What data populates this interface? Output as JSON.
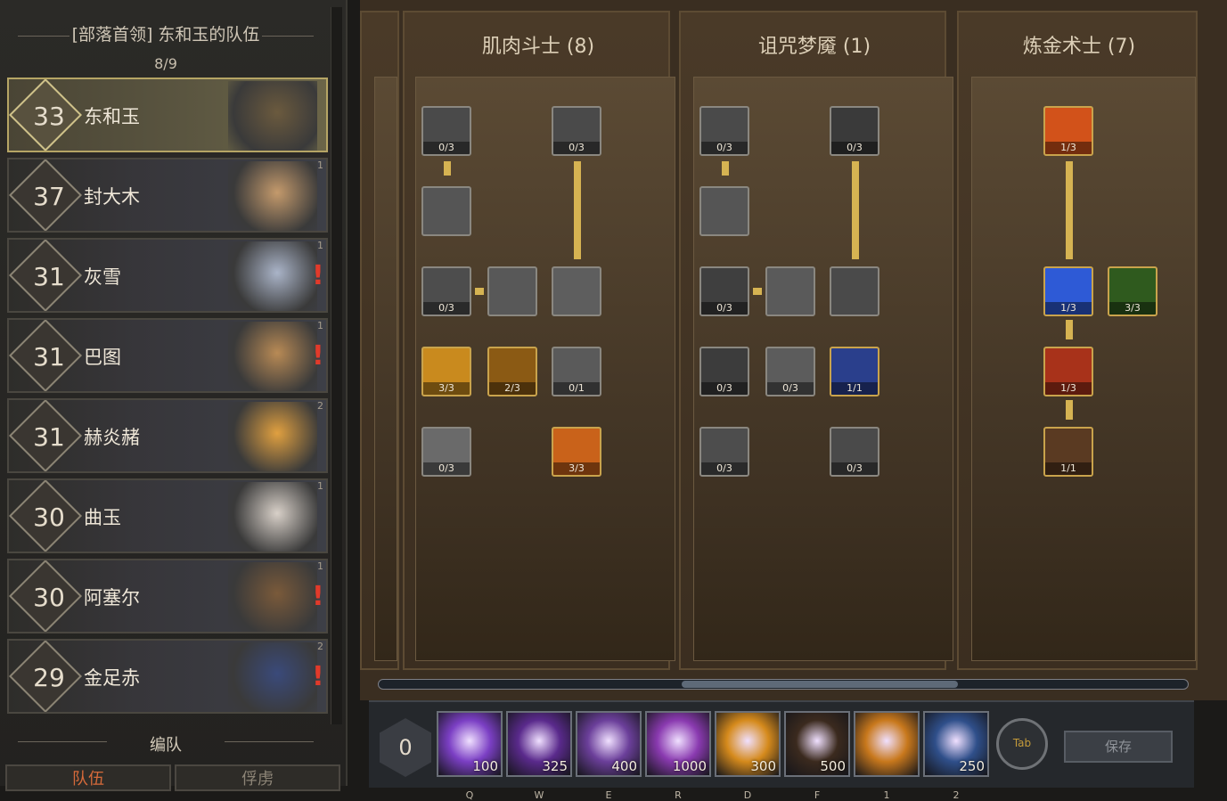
{
  "party": {
    "header": "[部落首领] 东和玉的队伍",
    "count": "8/9",
    "members": [
      {
        "level": "33",
        "name": "东和玉",
        "badge": "",
        "alert": "",
        "selected": true
      },
      {
        "level": "37",
        "name": "封大木",
        "badge": "1",
        "alert": ""
      },
      {
        "level": "31",
        "name": "灰雪",
        "badge": "1",
        "alert": "!"
      },
      {
        "level": "31",
        "name": "巴图",
        "badge": "1",
        "alert": "!"
      },
      {
        "level": "31",
        "name": "赫炎赭",
        "badge": "2",
        "alert": ""
      },
      {
        "level": "30",
        "name": "曲玉",
        "badge": "1",
        "alert": ""
      },
      {
        "level": "30",
        "name": "阿塞尔",
        "badge": "1",
        "alert": "!"
      },
      {
        "level": "29",
        "name": "金足赤",
        "badge": "2",
        "alert": "!"
      }
    ],
    "roster_label": "编队",
    "tabs": [
      "队伍",
      "俘虏"
    ]
  },
  "trees": [
    {
      "title": "肌肉斗士 (8)",
      "talents": [
        {
          "id": "t1",
          "count": "0/3"
        },
        {
          "id": "t2",
          "count": "0/3"
        },
        {
          "id": "t3",
          "count": ""
        },
        {
          "id": "t4",
          "count": "0/3"
        },
        {
          "id": "t5",
          "count": ""
        },
        {
          "id": "t6",
          "count": ""
        },
        {
          "id": "t7",
          "count": "3/3"
        },
        {
          "id": "t8",
          "count": "2/3"
        },
        {
          "id": "t9",
          "count": "0/1"
        },
        {
          "id": "t10",
          "count": "0/3"
        },
        {
          "id": "t11",
          "count": "3/3"
        }
      ]
    },
    {
      "title": "诅咒梦魇 (1)",
      "talents": [
        {
          "id": "c1",
          "count": "0/3"
        },
        {
          "id": "c2",
          "count": "0/3"
        },
        {
          "id": "c3",
          "count": ""
        },
        {
          "id": "c4",
          "count": "0/3"
        },
        {
          "id": "c5",
          "count": ""
        },
        {
          "id": "c6",
          "count": ""
        },
        {
          "id": "c7",
          "count": "0/3"
        },
        {
          "id": "c8",
          "count": "0/3"
        },
        {
          "id": "c9",
          "count": "1/1"
        },
        {
          "id": "c10",
          "count": "0/3"
        },
        {
          "id": "c11",
          "count": "0/3"
        }
      ]
    },
    {
      "title": "炼金术士 (7)",
      "talents": [
        {
          "id": "a1",
          "count": "1/3"
        },
        {
          "id": "a2",
          "count": "1/3"
        },
        {
          "id": "a3",
          "count": "3/3"
        },
        {
          "id": "a4",
          "count": "1/3"
        },
        {
          "id": "a5",
          "count": "1/1"
        }
      ]
    }
  ],
  "skill_bar": {
    "points": "0",
    "skills": [
      {
        "cost": "100",
        "key": "Q",
        "color": "#7b3fc4"
      },
      {
        "cost": "325",
        "key": "W",
        "color": "#5a2a8c"
      },
      {
        "cost": "400",
        "key": "E",
        "color": "#6b3f9a"
      },
      {
        "cost": "1000",
        "key": "R",
        "color": "#8a3ab0"
      },
      {
        "cost": "300",
        "key": "D",
        "color": "#d58a1c"
      },
      {
        "cost": "500",
        "key": "F",
        "color": "#3b2a1e"
      },
      {
        "cost": "",
        "key": "1",
        "color": "#c8781c"
      },
      {
        "cost": "250",
        "key": "2",
        "color": "#2f4f8a"
      }
    ],
    "tab_label": "Tab",
    "save_label": "保存"
  }
}
